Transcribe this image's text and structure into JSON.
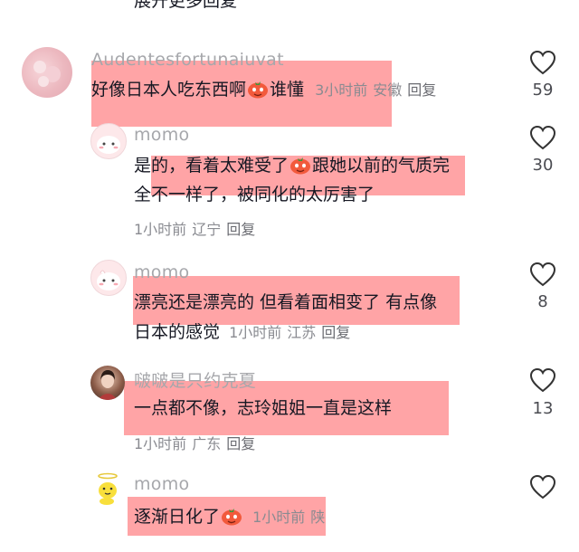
{
  "top_partial": "展开更多回复",
  "comments": [
    {
      "username": "Audentesfortunaiuvat",
      "text": "好像日本人吃东西啊",
      "text_after_emoji": "谁懂",
      "time": "3小时前",
      "location": "安徽",
      "reply": "回复",
      "likes": "59"
    },
    {
      "username": "momo",
      "line1_a": "是的，看着太难受了",
      "line1_b": "跟她以前的气质完",
      "line2": "全不一样了，被同化的太厉害了",
      "time": "1小时前",
      "location": "辽宁",
      "reply": "回复",
      "likes": "30"
    },
    {
      "username": "momo",
      "line1": "漂亮还是漂亮的 但看着面相变了 有点像",
      "line2": "日本的感觉",
      "time": "1小时前",
      "location": "江苏",
      "reply": "回复",
      "likes": "8"
    },
    {
      "username": "啵啵是只约克夏",
      "text": "一点都不像，志玲姐姐一直是这样",
      "time": "1小时前",
      "location": "广东",
      "reply": "回复",
      "likes": "13"
    },
    {
      "username": "momo",
      "text": "逐渐日化了",
      "time": "1小时前",
      "location_partial": "陕"
    }
  ],
  "icons": {
    "like": "heart-outline-icon",
    "emoji": "tomato-face-emoji"
  },
  "colors": {
    "highlight": "#ff6c70",
    "username": "#a6a7ab",
    "text": "#161823",
    "meta": "#8a8b91"
  }
}
